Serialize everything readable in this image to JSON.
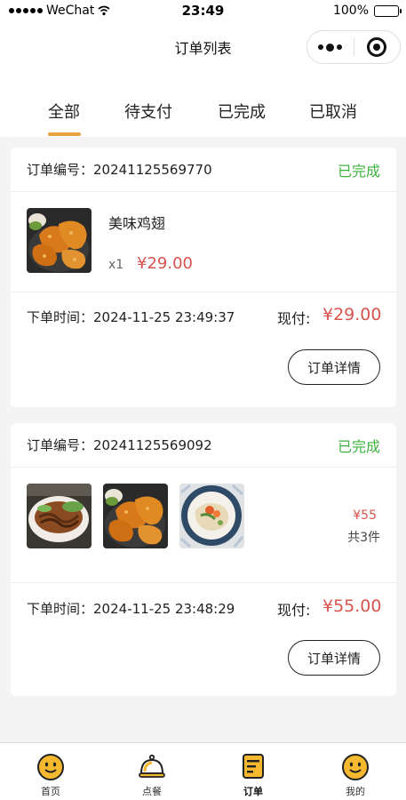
{
  "status_bar": {
    "carrier": "WeChat",
    "time": "23:49",
    "battery": "100%",
    "battery_level": 1.0
  },
  "nav": {
    "title": "订单列表"
  },
  "tabs": [
    {
      "label": "全部",
      "active": true
    },
    {
      "label": "待支付",
      "active": false
    },
    {
      "label": "已完成",
      "active": false
    },
    {
      "label": "已取消",
      "active": false
    }
  ],
  "orders": [
    {
      "order_no_label": "订单编号：",
      "order_no": "20241125569770",
      "status": "已完成",
      "item_name": "美味鸡翅",
      "item_qty": "x1",
      "item_price": "¥29.00",
      "time_label": "下单时间：",
      "time": "2024-11-25 23:49:37",
      "paid_label": "现付:",
      "paid_amount": "¥29.00",
      "detail_button": "订单详情"
    },
    {
      "order_no_label": "订单编号：",
      "order_no": "20241125569092",
      "status": "已完成",
      "total_price": "¥55",
      "total_count": "共3件",
      "time_label": "下单时间：",
      "time": "2024-11-25 23:48:29",
      "paid_label": "现付:",
      "paid_amount": "¥55.00",
      "detail_button": "订单详情"
    }
  ],
  "tabbar": [
    {
      "label": "首页",
      "icon": "smiley-icon"
    },
    {
      "label": "点餐",
      "icon": "cloche-icon"
    },
    {
      "label": "订单",
      "icon": "order-list-icon",
      "active": true
    },
    {
      "label": "我的",
      "icon": "smiley-icon"
    }
  ],
  "colors": {
    "accent": "#e6a23c",
    "status_done": "#3cb23c",
    "price": "#d9534f"
  }
}
